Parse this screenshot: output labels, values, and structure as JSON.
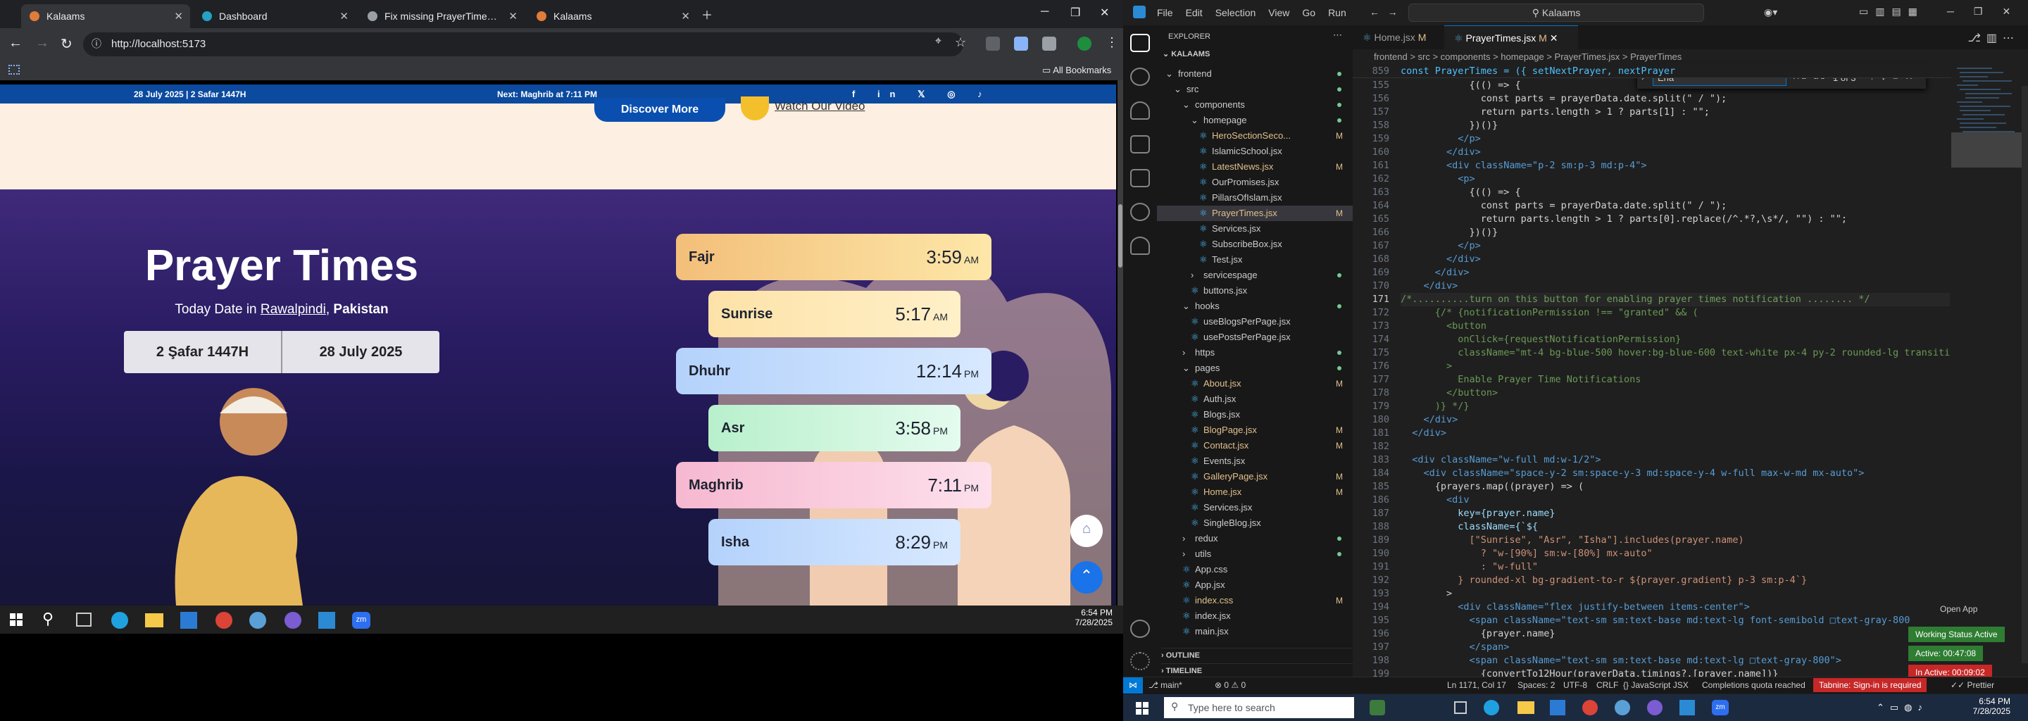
{
  "browser": {
    "tabs": [
      {
        "label": "Kalaams",
        "color": "#e37b3a"
      },
      {
        "label": "Dashboard",
        "color": "#25a2c3"
      },
      {
        "label": "Fix missing PrayerTimes compo",
        "color": "#9aa0a6"
      },
      {
        "label": "Kalaams",
        "color": "#e37b3a"
      }
    ],
    "url": "http://localhost:5173",
    "all_bookmarks": "All Bookmarks"
  },
  "site": {
    "topbar_date": "28 July 2025 | 2 Safar 1447H",
    "topbar_next_label": "Next:",
    "topbar_next_value": "Maghrib at 7:11 PM",
    "discover_btn": "Discover More",
    "watch_video": "Watch Our Video",
    "heading": "Prayer Times",
    "today_label": "Today Date in",
    "city": "Rawalpindi",
    "country": "Pakistan",
    "hijri": "2 Şafar 1447H",
    "gregorian": "28 July 2025",
    "prayers": [
      {
        "name": "Fajr",
        "time": "3:59",
        "ampm": "AM",
        "color": "#f4c77f"
      },
      {
        "name": "Sunrise",
        "time": "5:17",
        "ampm": "AM",
        "color": "#fde6b2"
      },
      {
        "name": "Dhuhr",
        "time": "12:14",
        "ampm": "PM",
        "color": "#bcd9fb"
      },
      {
        "name": "Asr",
        "time": "3:58",
        "ampm": "PM",
        "color": "#c4f5d6"
      },
      {
        "name": "Maghrib",
        "time": "7:11",
        "ampm": "PM",
        "color": "#f8c3d8"
      },
      {
        "name": "Isha",
        "time": "8:29",
        "ampm": "PM",
        "color": "#bcd9fb"
      }
    ]
  },
  "win_left_clock": {
    "time": "6:54 PM",
    "date": "7/28/2025"
  },
  "vscode": {
    "menu": [
      "File",
      "Edit",
      "Selection",
      "View",
      "Go",
      "Run"
    ],
    "search": "Kalaams",
    "explorer_title": "EXPLORER",
    "root": "KALAAMS",
    "tree": [
      {
        "d": 1,
        "t": "frontend",
        "k": "f"
      },
      {
        "d": 2,
        "t": "src",
        "k": "f"
      },
      {
        "d": 3,
        "t": "components",
        "k": "f"
      },
      {
        "d": 4,
        "t": "homepage",
        "k": "f"
      },
      {
        "d": 5,
        "t": "HeroSectionSeco...",
        "s": "M"
      },
      {
        "d": 5,
        "t": "IslamicSchool.jsx"
      },
      {
        "d": 5,
        "t": "LatestNews.jsx",
        "s": "M"
      },
      {
        "d": 5,
        "t": "OurPromises.jsx"
      },
      {
        "d": 5,
        "t": "PillarsOfIslam.jsx"
      },
      {
        "d": 5,
        "t": "PrayerTimes.jsx",
        "s": "M",
        "sel": true
      },
      {
        "d": 5,
        "t": "Services.jsx"
      },
      {
        "d": 5,
        "t": "SubscribeBox.jsx"
      },
      {
        "d": 5,
        "t": "Test.jsx"
      },
      {
        "d": 4,
        "t": "servicespage",
        "k": "c"
      },
      {
        "d": 4,
        "t": "buttons.jsx"
      },
      {
        "d": 3,
        "t": "hooks",
        "k": "f"
      },
      {
        "d": 4,
        "t": "useBlogsPerPage.jsx"
      },
      {
        "d": 4,
        "t": "usePostsPerPage.jsx"
      },
      {
        "d": 3,
        "t": "https",
        "k": "c"
      },
      {
        "d": 3,
        "t": "pages",
        "k": "f"
      },
      {
        "d": 4,
        "t": "About.jsx",
        "s": "M"
      },
      {
        "d": 4,
        "t": "Auth.jsx"
      },
      {
        "d": 4,
        "t": "Blogs.jsx"
      },
      {
        "d": 4,
        "t": "BlogPage.jsx",
        "s": "M"
      },
      {
        "d": 4,
        "t": "Contact.jsx",
        "s": "M"
      },
      {
        "d": 4,
        "t": "Events.jsx"
      },
      {
        "d": 4,
        "t": "GalleryPage.jsx",
        "s": "M"
      },
      {
        "d": 4,
        "t": "Home.jsx",
        "s": "M"
      },
      {
        "d": 4,
        "t": "Services.jsx"
      },
      {
        "d": 4,
        "t": "SingleBlog.jsx"
      },
      {
        "d": 3,
        "t": "redux",
        "k": "c"
      },
      {
        "d": 3,
        "t": "utils",
        "k": "c"
      },
      {
        "d": 3,
        "t": "App.css"
      },
      {
        "d": 3,
        "t": "App.jsx"
      },
      {
        "d": 3,
        "t": "index.css",
        "s": "M"
      },
      {
        "d": 3,
        "t": "index.jsx"
      },
      {
        "d": 3,
        "t": "main.jsx"
      }
    ],
    "outline": "OUTLINE",
    "timeline": "TIMELINE",
    "tabs": [
      {
        "label": "Home.jsx",
        "s": "M"
      },
      {
        "label": "PrayerTimes.jsx",
        "s": "M"
      }
    ],
    "breadcrumb": "frontend > src > components > homepage > PrayerTimes.jsx > PrayerTimes",
    "find_query": "Ena",
    "find_result": "1 of 3",
    "sticky_ln": "859",
    "sticky": "const PrayerTimes = ({ setNextPrayer, nextPrayer",
    "lines": [
      {
        "n": "155",
        "t": "            {(() => {",
        "c": ""
      },
      {
        "n": "156",
        "t": "              const parts = prayerData.date.split(\" / \");",
        "c": ""
      },
      {
        "n": "157",
        "t": "              return parts.length > 1 ? parts[1] : \"\";",
        "c": ""
      },
      {
        "n": "158",
        "t": "            })()}",
        "c": ""
      },
      {
        "n": "159",
        "t": "          </p>",
        "c": "tag"
      },
      {
        "n": "160",
        "t": "        </div>",
        "c": "tag"
      },
      {
        "n": "161",
        "t": "        <div className=\"p-2 sm:p-3 md:p-4\">",
        "c": "tag"
      },
      {
        "n": "162",
        "t": "          <p>",
        "c": "tag"
      },
      {
        "n": "163",
        "t": "            {(() => {",
        "c": ""
      },
      {
        "n": "164",
        "t": "              const parts = prayerData.date.split(\" / \");",
        "c": ""
      },
      {
        "n": "165",
        "t": "              return parts.length > 1 ? parts[0].replace(/^.*?,\\s*/, \"\") : \"\";",
        "c": ""
      },
      {
        "n": "166",
        "t": "            })()}",
        "c": ""
      },
      {
        "n": "167",
        "t": "          </p>",
        "c": "tag"
      },
      {
        "n": "168",
        "t": "        </div>",
        "c": "tag"
      },
      {
        "n": "169",
        "t": "      </div>",
        "c": "tag"
      },
      {
        "n": "170",
        "t": "    </div>",
        "c": "tag"
      },
      {
        "n": "171",
        "t": "/*..........turn on this button for enabling prayer times notification ........ */",
        "c": "cmt"
      },
      {
        "n": "172",
        "t": "      {/* {notificationPermission !== \"granted\" && (",
        "c": "cmt"
      },
      {
        "n": "173",
        "t": "        <button",
        "c": "cmt"
      },
      {
        "n": "174",
        "t": "          onClick={requestNotificationPermission}",
        "c": "cmt"
      },
      {
        "n": "175",
        "t": "          className=\"mt-4 bg-blue-500 hover:bg-blue-600 text-white px-4 py-2 rounded-lg transiti",
        "c": "cmt"
      },
      {
        "n": "176",
        "t": "        >",
        "c": "cmt"
      },
      {
        "n": "177",
        "t": "          Enable Prayer Time Notifications",
        "c": "cmt"
      },
      {
        "n": "178",
        "t": "        </button>",
        "c": "cmt"
      },
      {
        "n": "179",
        "t": "      )} */}",
        "c": "cmt"
      },
      {
        "n": "180",
        "t": "    </div>",
        "c": "tag"
      },
      {
        "n": "181",
        "t": "  </div>",
        "c": "tag"
      },
      {
        "n": "182",
        "t": "",
        "c": ""
      },
      {
        "n": "183",
        "t": "  <div className=\"w-full md:w-1/2\">",
        "c": "tag"
      },
      {
        "n": "184",
        "t": "    <div className=\"space-y-2 sm:space-y-3 md:space-y-4 w-full max-w-md mx-auto\">",
        "c": "tag"
      },
      {
        "n": "185",
        "t": "      {prayers.map((prayer) => (",
        "c": ""
      },
      {
        "n": "186",
        "t": "        <div",
        "c": "tag"
      },
      {
        "n": "187",
        "t": "          key={prayer.name}",
        "c": "attr"
      },
      {
        "n": "188",
        "t": "          className={`${",
        "c": "attr"
      },
      {
        "n": "189",
        "t": "            [\"Sunrise\", \"Asr\", \"Isha\"].includes(prayer.name)",
        "c": "str"
      },
      {
        "n": "190",
        "t": "              ? \"w-[90%] sm:w-[80%] mx-auto\"",
        "c": "str"
      },
      {
        "n": "191",
        "t": "              : \"w-full\"",
        "c": "str"
      },
      {
        "n": "192",
        "t": "          } rounded-xl bg-gradient-to-r ${prayer.gradient} p-3 sm:p-4`}",
        "c": "str"
      },
      {
        "n": "193",
        "t": "        >",
        "c": ""
      },
      {
        "n": "194",
        "t": "          <div className=\"flex justify-between items-center\">",
        "c": "tag"
      },
      {
        "n": "195",
        "t": "            <span className=\"text-sm sm:text-base md:text-lg font-semibold □text-gray-800",
        "c": "tag"
      },
      {
        "n": "196",
        "t": "              {prayer.name}",
        "c": ""
      },
      {
        "n": "197",
        "t": "            </span>",
        "c": "tag"
      },
      {
        "n": "198",
        "t": "            <span className=\"text-sm sm:text-base md:text-lg □text-gray-800\">",
        "c": "tag"
      },
      {
        "n": "199",
        "t": "              {convertTo12Hour(prayerData.timings?.[prayer.name])}",
        "c": ""
      }
    ],
    "open_app": "Open App",
    "status": {
      "branch": "main*",
      "errors": "⊗ 0 ⚠ 0",
      "pos": "Ln 1171, Col 17",
      "spaces": "Spaces: 2",
      "enc": "UTF-8",
      "eol": "CRLF",
      "lang": "{} JavaScript JSX",
      "quota": "Completions quota reached",
      "tabnine": "Tabnine: Sign-in is required",
      "prettier": "Prettier"
    },
    "work_badges": [
      "Working Status Active",
      "Active: 00:47:08",
      "In Active: 00:09:02"
    ]
  },
  "win_right": {
    "search": "Type here to search",
    "time": "6:54 PM",
    "date": "7/28/2025"
  }
}
